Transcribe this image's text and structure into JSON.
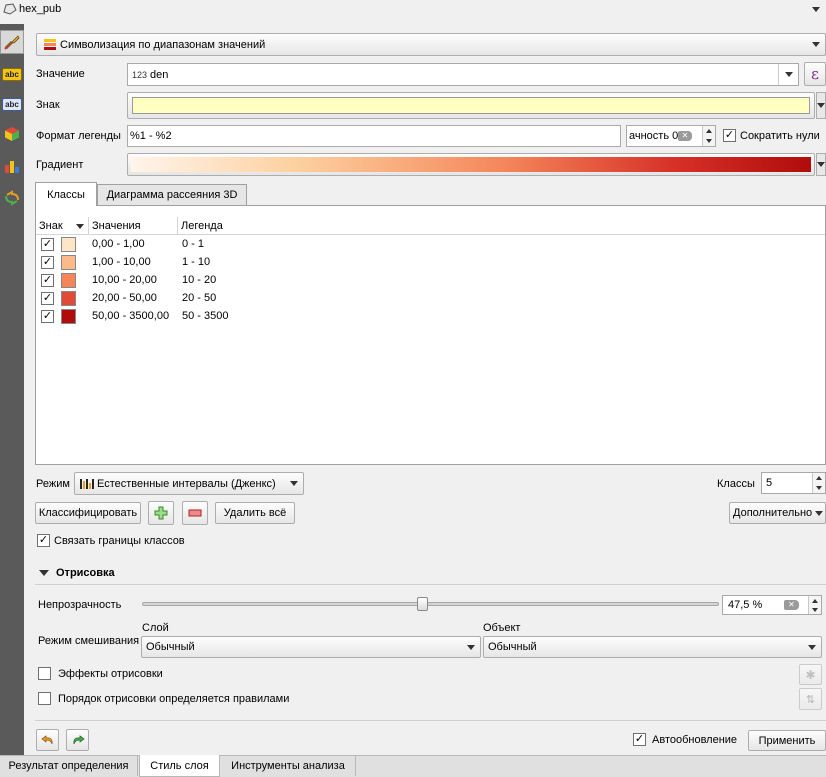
{
  "window": {
    "title": "hex_pub"
  },
  "renderer": {
    "selected": "Символизация по диапазонам значений"
  },
  "form": {
    "value_label": "Значение",
    "value_type_badge": "123",
    "value_field": "den",
    "symbol_label": "Знак",
    "legend_format_label": "Формат легенды",
    "legend_format_value": "%1 - %2",
    "precision_text": "ачность 0",
    "trim_zeros_label": "Сократить нули",
    "gradient_label": "Градиент"
  },
  "tabs": [
    "Классы",
    "Диаграмма рассеяния 3D"
  ],
  "table": {
    "headers": [
      "Знак",
      "Значения",
      "Легенда"
    ],
    "rows": [
      {
        "values": "0,00 - 1,00",
        "legend": "0 - 1",
        "color": "#fee5c8"
      },
      {
        "values": "1,00 - 10,00",
        "legend": "1 - 10",
        "color": "#fcba8a"
      },
      {
        "values": "10,00 - 20,00",
        "legend": "10 - 20",
        "color": "#f4865a"
      },
      {
        "values": "20,00 - 50,00",
        "legend": "20 - 50",
        "color": "#e04a36"
      },
      {
        "values": "50,00 - 3500,00",
        "legend": "50 - 3500",
        "color": "#b00c0c"
      }
    ]
  },
  "mode": {
    "label": "Режим",
    "value": "Естественные интервалы (Дженкс)",
    "classes_label": "Классы",
    "classes_value": "5"
  },
  "actions": {
    "classify": "Классифицировать",
    "delete_all": "Удалить всё",
    "advanced": "Дополнительно"
  },
  "link_bounds": "Связать границы классов",
  "render": {
    "section_title": "Отрисовка",
    "opacity_label": "Непрозрачность",
    "opacity_value": "47,5 %",
    "opacity_fraction": 0.475,
    "blend_label": "Режим смешивания",
    "layer_label": "Слой",
    "layer_value": "Обычный",
    "object_label": "Объект",
    "object_value": "Обычный",
    "effects_label": "Эффекты отрисовки",
    "order_label": "Порядок отрисовки определяется правилами"
  },
  "footer": {
    "auto_update": "Автообновление",
    "apply": "Применить"
  },
  "bottom_tabs": [
    "Результат определения",
    "Стиль слоя",
    "Инструменты анализа"
  ],
  "colors": {
    "symbol_fill": "#ffffc2",
    "gradient_start": "#fff5eb",
    "gradient_mid": "#f4865a",
    "gradient_end": "#b00c0c",
    "sidebar": "#5a5a5a"
  }
}
